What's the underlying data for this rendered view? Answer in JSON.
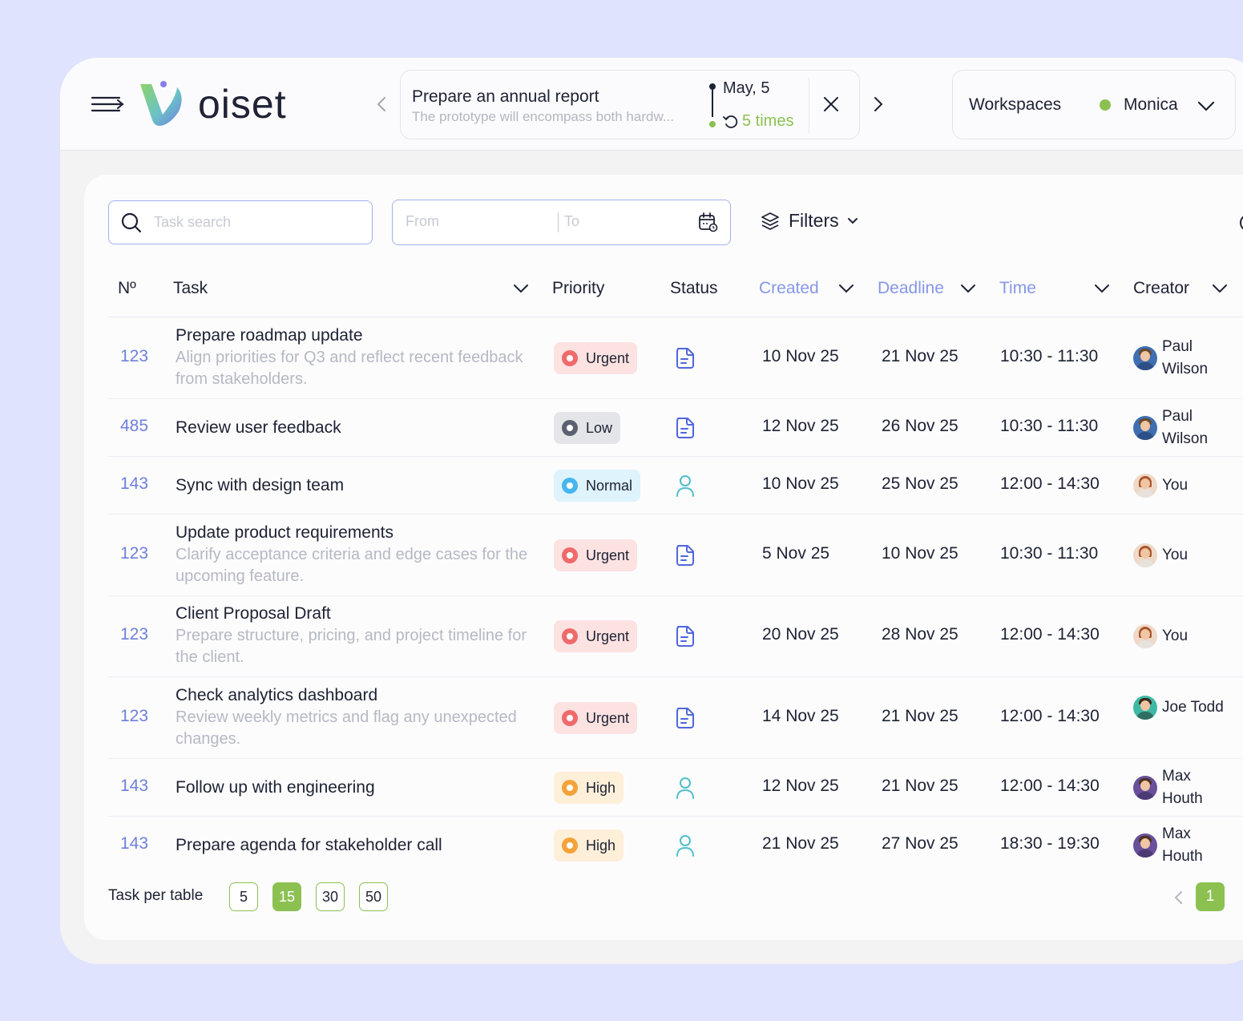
{
  "app": {
    "logo_text": "oiset",
    "brand_colors": {
      "logo_gradient_start": "#8cd36a",
      "logo_gradient_end": "#6d7fe3",
      "accent_green": "#8cc152",
      "accent_blue": "#8797e6"
    }
  },
  "header": {
    "reminder": {
      "title": "Prepare an annual report",
      "subtitle": "The prototype will encompass both hardw...",
      "date": "May, 5",
      "repeat": "5 times"
    },
    "workspace": {
      "label": "Workspaces",
      "user": "Monica",
      "status_color": "#8cc152"
    }
  },
  "toolbar": {
    "search_placeholder": "Task search",
    "from_placeholder": "From",
    "to_placeholder": "To",
    "filters_label": "Filters"
  },
  "table": {
    "columns": {
      "num": "Nº",
      "task": "Task",
      "priority": "Priority",
      "status": "Status",
      "created": "Created",
      "deadline": "Deadline",
      "time": "Time",
      "creator": "Creator"
    },
    "rows": [
      {
        "num": "123",
        "title": "Prepare roadmap update",
        "desc": "Align priorities for Q3 and reflect recent feedback from stakeholders.",
        "priority": "Urgent",
        "status_icon": "document-icon",
        "created": "10 Nov 25",
        "deadline": "21 Nov 25",
        "time": "10:30 - 11:30",
        "creator": "Paul Wilson"
      },
      {
        "num": "485",
        "title": "Review user feedback",
        "desc": "",
        "priority": "Low",
        "status_icon": "document-icon",
        "created": "12 Nov 25",
        "deadline": "26 Nov 25",
        "time": "10:30 - 11:30",
        "creator": "Paul Wilson"
      },
      {
        "num": "143",
        "title": "Sync with design team",
        "desc": "",
        "priority": "Normal",
        "status_icon": "user-icon",
        "created": "10 Nov 25",
        "deadline": "25 Nov 25",
        "time": "12:00 - 14:30",
        "creator": "You"
      },
      {
        "num": "123",
        "title": "Update product requirements",
        "desc": "Clarify acceptance criteria and edge cases for the upcoming feature.",
        "priority": "Urgent",
        "status_icon": "document-icon",
        "created": "5 Nov 25",
        "deadline": "10 Nov 25",
        "time": "10:30 - 11:30",
        "creator": "You"
      },
      {
        "num": "123",
        "title": "Client Proposal Draft",
        "desc": "Prepare structure, pricing, and project timeline for the client.",
        "priority": "Urgent",
        "status_icon": "document-icon",
        "created": "20 Nov 25",
        "deadline": "28 Nov 25",
        "time": "12:00 - 14:30",
        "creator": "You"
      },
      {
        "num": "123",
        "title": "Check analytics dashboard",
        "desc": "Review weekly metrics and flag any unexpected changes.",
        "priority": "Urgent",
        "status_icon": "document-icon",
        "created": "14 Nov 25",
        "deadline": "21 Nov 25",
        "time": "12:00 - 14:30",
        "creator": "Joe Todd"
      },
      {
        "num": "143",
        "title": "Follow up with engineering",
        "desc": "",
        "priority": "High",
        "status_icon": "user-icon",
        "created": "12 Nov 25",
        "deadline": "21 Nov 25",
        "time": "12:00 - 14:30",
        "creator": "Max Houth"
      },
      {
        "num": "143",
        "title": "Prepare agenda for stakeholder call",
        "desc": "",
        "priority": "High",
        "status_icon": "user-icon",
        "created": "21 Nov 25",
        "deadline": "27 Nov 25",
        "time": "18:30 - 19:30",
        "creator": "Max Houth"
      }
    ]
  },
  "footer": {
    "per_page_label": "Task per table",
    "per_page_options": [
      "5",
      "15",
      "30",
      "50"
    ],
    "per_page_selected": "15",
    "current_page": "1"
  }
}
